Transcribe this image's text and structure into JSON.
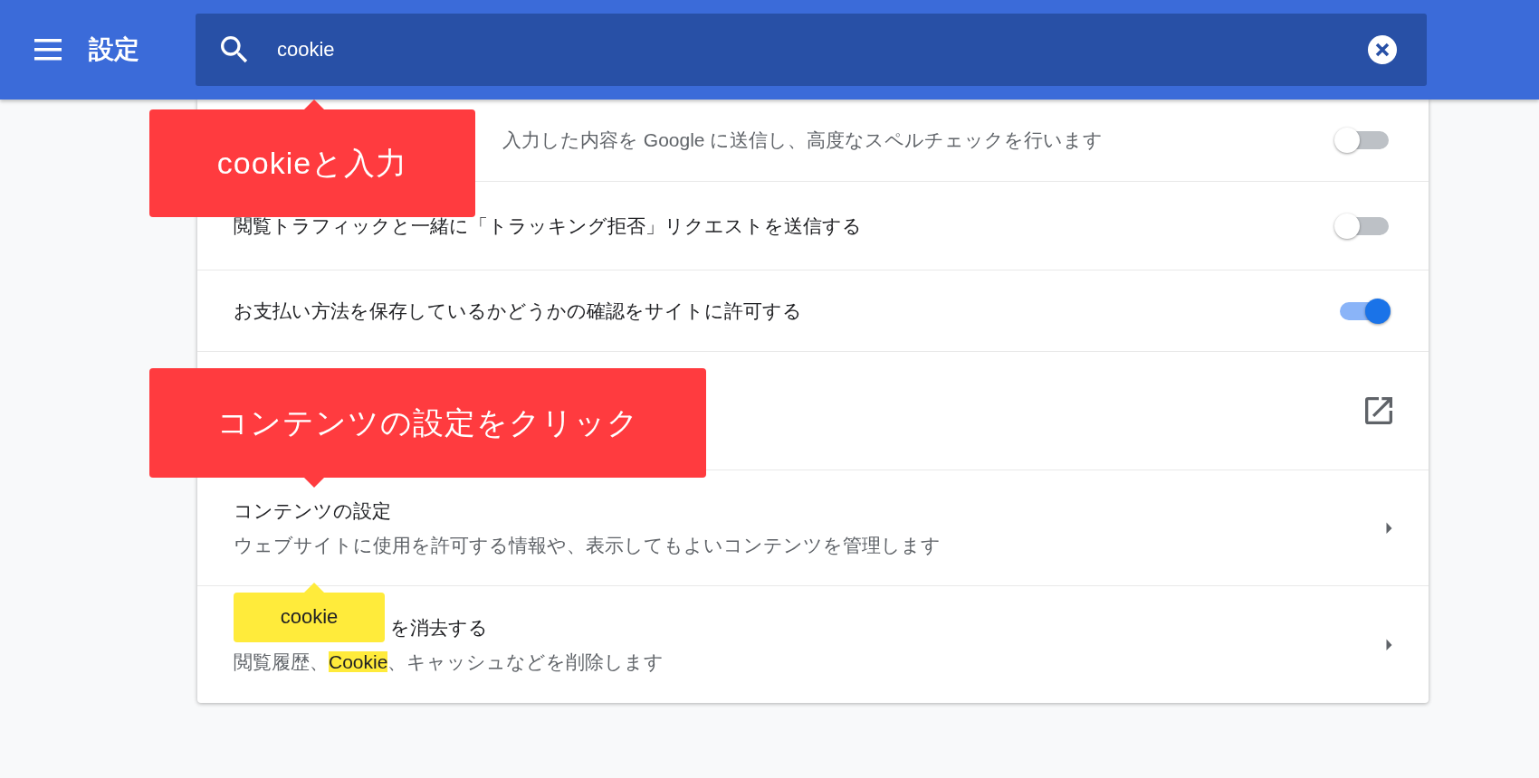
{
  "header": {
    "title": "設定",
    "search": {
      "value": "cookie"
    }
  },
  "rows": [
    {
      "kind": "toggle",
      "on": false,
      "subtitle": [
        {
          "text": "入力した内容を Google に送信し、高度なスペルチェックを行います",
          "highlighted": false
        }
      ]
    },
    {
      "kind": "toggle",
      "on": false,
      "title": "閲覧トラフィックと一緒に「トラッキング拒否」リクエストを送信する"
    },
    {
      "kind": "toggle",
      "on": true,
      "title": "お支払い方法を保存しているかどうかの確認をサイトに許可する"
    },
    {
      "kind": "external"
    },
    {
      "kind": "arrow",
      "title": "コンテンツの設定",
      "subtitle": [
        {
          "text": "ウェブサイトに使用を許可する情報や、表示してもよいコンテンツを管理します",
          "highlighted": false
        }
      ]
    },
    {
      "kind": "arrow",
      "title": "を消去する",
      "subtitle": [
        {
          "text": "閲覧履歴、",
          "highlighted": false
        },
        {
          "text": "Cookie",
          "highlighted": true
        },
        {
          "text": "、キャッシュなどを削除します",
          "highlighted": false
        }
      ]
    }
  ],
  "callouts": [
    {
      "kind": "red",
      "text": "cookieと入力"
    },
    {
      "kind": "red",
      "text": "コンテンツの設定をクリック"
    },
    {
      "kind": "yellow",
      "text": "cookie"
    }
  ]
}
